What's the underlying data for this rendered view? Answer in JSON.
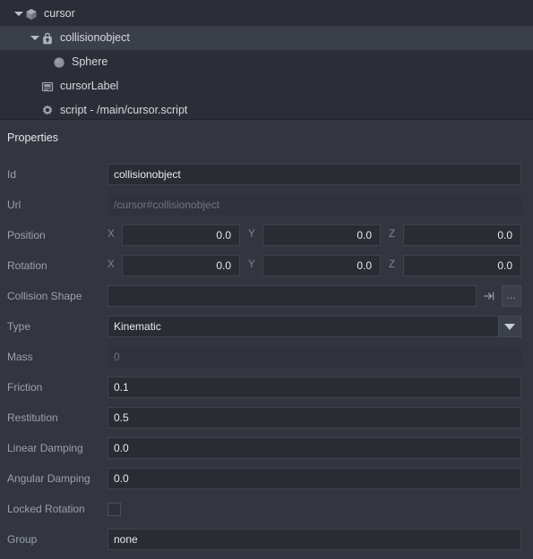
{
  "outline": {
    "items": [
      {
        "label": "cursor",
        "icon": "cube-icon",
        "depth": 0,
        "twisty": "open",
        "selected": false
      },
      {
        "label": "collisionobject",
        "icon": "collision-object-icon",
        "depth": 1,
        "twisty": "open",
        "selected": true
      },
      {
        "label": "Sphere",
        "icon": "sphere-icon",
        "depth": 2,
        "twisty": "none",
        "selected": false
      },
      {
        "label": "cursorLabel",
        "icon": "label-icon",
        "depth": 1,
        "twisty": "none",
        "selected": false
      },
      {
        "label": "script - /main/cursor.script",
        "icon": "gear-icon",
        "depth": 1,
        "twisty": "none",
        "selected": false
      }
    ]
  },
  "properties": {
    "header": "Properties",
    "id": {
      "label": "Id",
      "value": "collisionobject"
    },
    "url": {
      "label": "Url",
      "value": "/cursor#collisionobject"
    },
    "position": {
      "label": "Position",
      "x_label": "X",
      "x": "0.0",
      "y_label": "Y",
      "y": "0.0",
      "z_label": "Z",
      "z": "0.0"
    },
    "rotation": {
      "label": "Rotation",
      "x_label": "X",
      "x": "0.0",
      "y_label": "Y",
      "y": "0.0",
      "z_label": "Z",
      "z": "0.0"
    },
    "collision_shape": {
      "label": "Collision Shape",
      "value": "",
      "browse_label": "…"
    },
    "type": {
      "label": "Type",
      "value": "Kinematic"
    },
    "mass": {
      "label": "Mass",
      "value": "0"
    },
    "friction": {
      "label": "Friction",
      "value": "0.1"
    },
    "restitution": {
      "label": "Restitution",
      "value": "0.5"
    },
    "linear_damping": {
      "label": "Linear Damping",
      "value": "0.0"
    },
    "angular_damping": {
      "label": "Angular Damping",
      "value": "0.0"
    },
    "locked_rotation": {
      "label": "Locked Rotation",
      "checked": false
    },
    "group": {
      "label": "Group",
      "value": "none"
    }
  },
  "colors": {
    "panel_bg": "#33363f",
    "tree_bg": "#2b2e36",
    "selection": "#3b3f4a",
    "field_bg": "#292c33",
    "label_text": "#9aa0ab",
    "value_text": "#e8eaee"
  }
}
